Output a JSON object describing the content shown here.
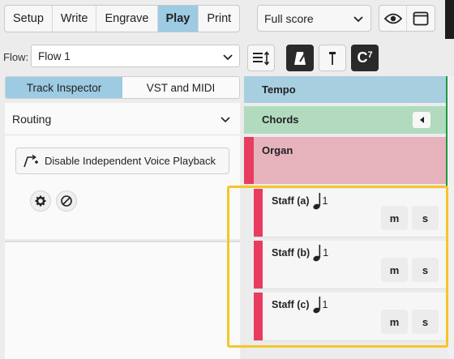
{
  "modes": [
    "Setup",
    "Write",
    "Engrave",
    "Play",
    "Print"
  ],
  "active_mode": "Play",
  "layout_select": {
    "value": "Full score"
  },
  "view_icons": [
    "eye-icon",
    "window-icon"
  ],
  "flow": {
    "label": "Flow:",
    "value": "Flow 1"
  },
  "toolbar_icons": [
    "track-height-icon",
    "metronome-icon",
    "click-icon",
    "chord-symbol-icon"
  ],
  "chord_symbol": {
    "letter": "C",
    "superscript": "7"
  },
  "inspector": {
    "tabs": [
      "Track Inspector",
      "VST and MIDI"
    ],
    "active_tab": "Track Inspector",
    "section": "Routing",
    "voice_button": "Disable Independent Voice Playback",
    "action_icons": [
      "gear-icon",
      "edit-icon"
    ]
  },
  "tracks": {
    "tempo": "Tempo",
    "chords": "Chords",
    "instrument": "Organ",
    "staves": [
      {
        "name": "Staff (a)",
        "voice": "1",
        "mute": "m",
        "solo": "s"
      },
      {
        "name": "Staff (b)",
        "voice": "1",
        "mute": "m",
        "solo": "s"
      },
      {
        "name": "Staff (c)",
        "voice": "1",
        "mute": "m",
        "solo": "s"
      }
    ]
  },
  "colors": {
    "accent": "#9ccbe3",
    "organ": "#e83c5e",
    "highlight": "#f5c52a",
    "tempo": "#a8cfe0",
    "chords": "#b2dabf"
  }
}
